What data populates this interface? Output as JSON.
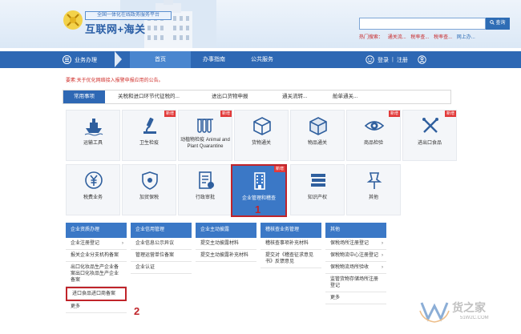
{
  "header": {
    "logo_tagline": "全国一体化在线政务服务平台",
    "logo_title": "互联网+海关",
    "search": {
      "placeholder": "",
      "button_label": "查询"
    },
    "hot_search": {
      "label": "热门搜索：",
      "terms": [
        "通关流...",
        "税率查...",
        "税率查...",
        "网上办..."
      ]
    }
  },
  "nav": {
    "menu_label": "业务办理",
    "items": [
      "首页",
      "办事指南",
      "公共服务"
    ],
    "active_item": "首页",
    "login": "登录",
    "separator": "|",
    "register": "注册"
  },
  "notice": "要素:关于优化网络接入报警申报应用的公告。",
  "quick_bar": {
    "tab": "常用事项",
    "items": [
      "关税和进口环节代征税的...",
      "进出口货物申报",
      "通关流转...",
      "舱单通关..."
    ]
  },
  "badge_text": "新增",
  "tiles": [
    {
      "label": "运输工具",
      "icon": "ship-icon",
      "badge": false
    },
    {
      "label": "卫生检疫",
      "icon": "microscope-icon",
      "badge": true
    },
    {
      "label": "动植物检疫 Animal and Plant Quarantine",
      "icon": "plant-quarantine-icon",
      "badge": true
    },
    {
      "label": "货物通关",
      "icon": "cargo-box-icon",
      "badge": false
    },
    {
      "label": "物品通关",
      "icon": "package-icon",
      "badge": false
    },
    {
      "label": "商品检验",
      "icon": "eye-inspection-icon",
      "badge": true
    },
    {
      "label": "进出口食品",
      "icon": "food-icon",
      "badge": true
    },
    {
      "label": "税费业务",
      "icon": "yen-coin-icon",
      "badge": false
    },
    {
      "label": "加贸保税",
      "icon": "bonded-shield-icon",
      "badge": false
    },
    {
      "label": "行政审批",
      "icon": "approval-document-icon",
      "badge": false
    },
    {
      "label": "企业管理和稽查",
      "icon": "building-icon",
      "badge": true
    },
    {
      "label": "知识产权",
      "icon": "books-icon",
      "badge": false
    },
    {
      "label": "其他",
      "icon": "pin-icon",
      "badge": false
    }
  ],
  "step_numbers": [
    "1",
    "2"
  ],
  "dropdown_columns": [
    {
      "head": "企业资质办理",
      "items": [
        "企业注册登记",
        "报关企业分支机构备案",
        "出口化妆品生产企业备案出口化妆品生产企业备案",
        "进口食品进口商备案",
        "更多"
      ]
    },
    {
      "head": "企业信用管理",
      "items": [
        "企业信息公示异议",
        "管理运营单位备案",
        "企业认证"
      ]
    },
    {
      "head": "企业主动披露",
      "items": [
        "提交主动披露材料",
        "提交主动披露补充材料"
      ]
    },
    {
      "head": "稽核查业务管理",
      "items": [
        "稽核查事项补充材料",
        "提交对《稽查征求意见书》反馈意见"
      ]
    },
    {
      "head": "其他",
      "items": [
        "保税场所注册登记",
        "保税物流中心注册登记",
        "保税物流场所验收",
        "监管货物存储场所注册登记",
        "更多"
      ]
    }
  ],
  "watermark": {
    "text": "货之家",
    "url": "51W2C.COM"
  }
}
